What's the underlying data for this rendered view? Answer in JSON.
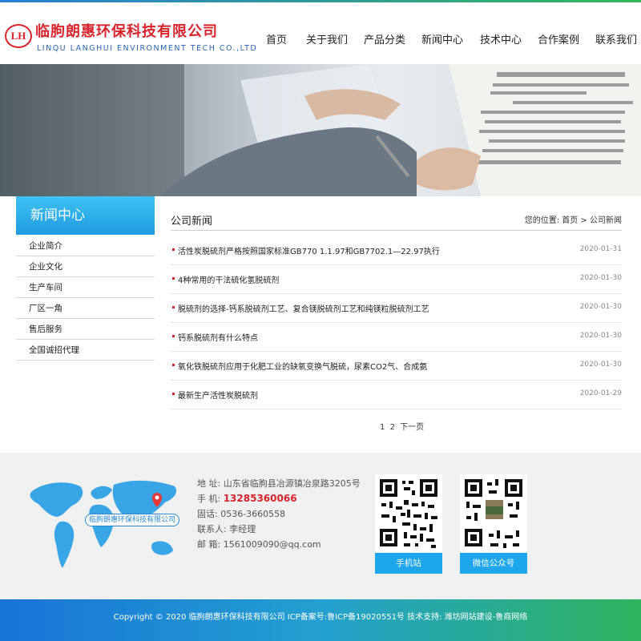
{
  "header": {
    "logo_mark": "LH",
    "company_cn": "临朐朗惠环保科技有限公司",
    "company_en": "LINQU LANGHUI ENVIRONMENT TECH CO.,LTD",
    "nav": [
      "首页",
      "关于我们",
      "产品分类",
      "新闻中心",
      "技术中心",
      "合作案例",
      "联系我们"
    ]
  },
  "sidebar": {
    "title": "新闻中心",
    "items": [
      "企业简介",
      "企业文化",
      "生产车间",
      "厂区一角",
      "售后服务",
      "全国诚招代理"
    ]
  },
  "main": {
    "title": "公司新闻",
    "breadcrumb": "您的位置: 首页 > 公司新闻",
    "news": [
      {
        "title": "活性炭脱硫剂严格按照国家标准GB770 1.1.97和GB7702.1—22.97执行",
        "date": "2020-01-31"
      },
      {
        "title": "4种常用的干法硫化氢脱硫剂",
        "date": "2020-01-30"
      },
      {
        "title": "脱硫剂的选择-钙系脱硫剂工艺、复合镁脱硫剂工艺和纯镁粒脱硫剂工艺",
        "date": "2020-01-30"
      },
      {
        "title": "钙系脱硫剂有什么特点",
        "date": "2020-01-30"
      },
      {
        "title": "氧化铁脱硫剂应用于化肥工业的缺氧变换气脱硫，尿素CO2气、合成氨",
        "date": "2020-01-30"
      },
      {
        "title": "最新生产活性炭脱硫剂",
        "date": "2020-01-29"
      }
    ],
    "pager": [
      "1",
      "2",
      "下一页"
    ]
  },
  "footer": {
    "map_label": "临朐朗惠环保科技有限公司",
    "address": "地 址: 山东省临朐县冶源镇冶泉路3205号",
    "mobile_label": "手 机: ",
    "mobile": "13285360066",
    "phone": "固话: 0536-3660558",
    "contact": "联系人: 李经理",
    "email": "邮 箱: 1561009090@qq.com",
    "qr_mobile": "手机站",
    "qr_wechat": "微信公众号",
    "copyright": "Copyright © 2020 临朐朗惠环保科技有限公司    ICP备案号:鲁ICP备19020551号    技术支持: 潍坊网站建设-鲁商网络"
  },
  "colors": {
    "brand_red": "#d9232b",
    "brand_blue": "#1ea6ec",
    "highlight_phone": "#d9232b"
  }
}
